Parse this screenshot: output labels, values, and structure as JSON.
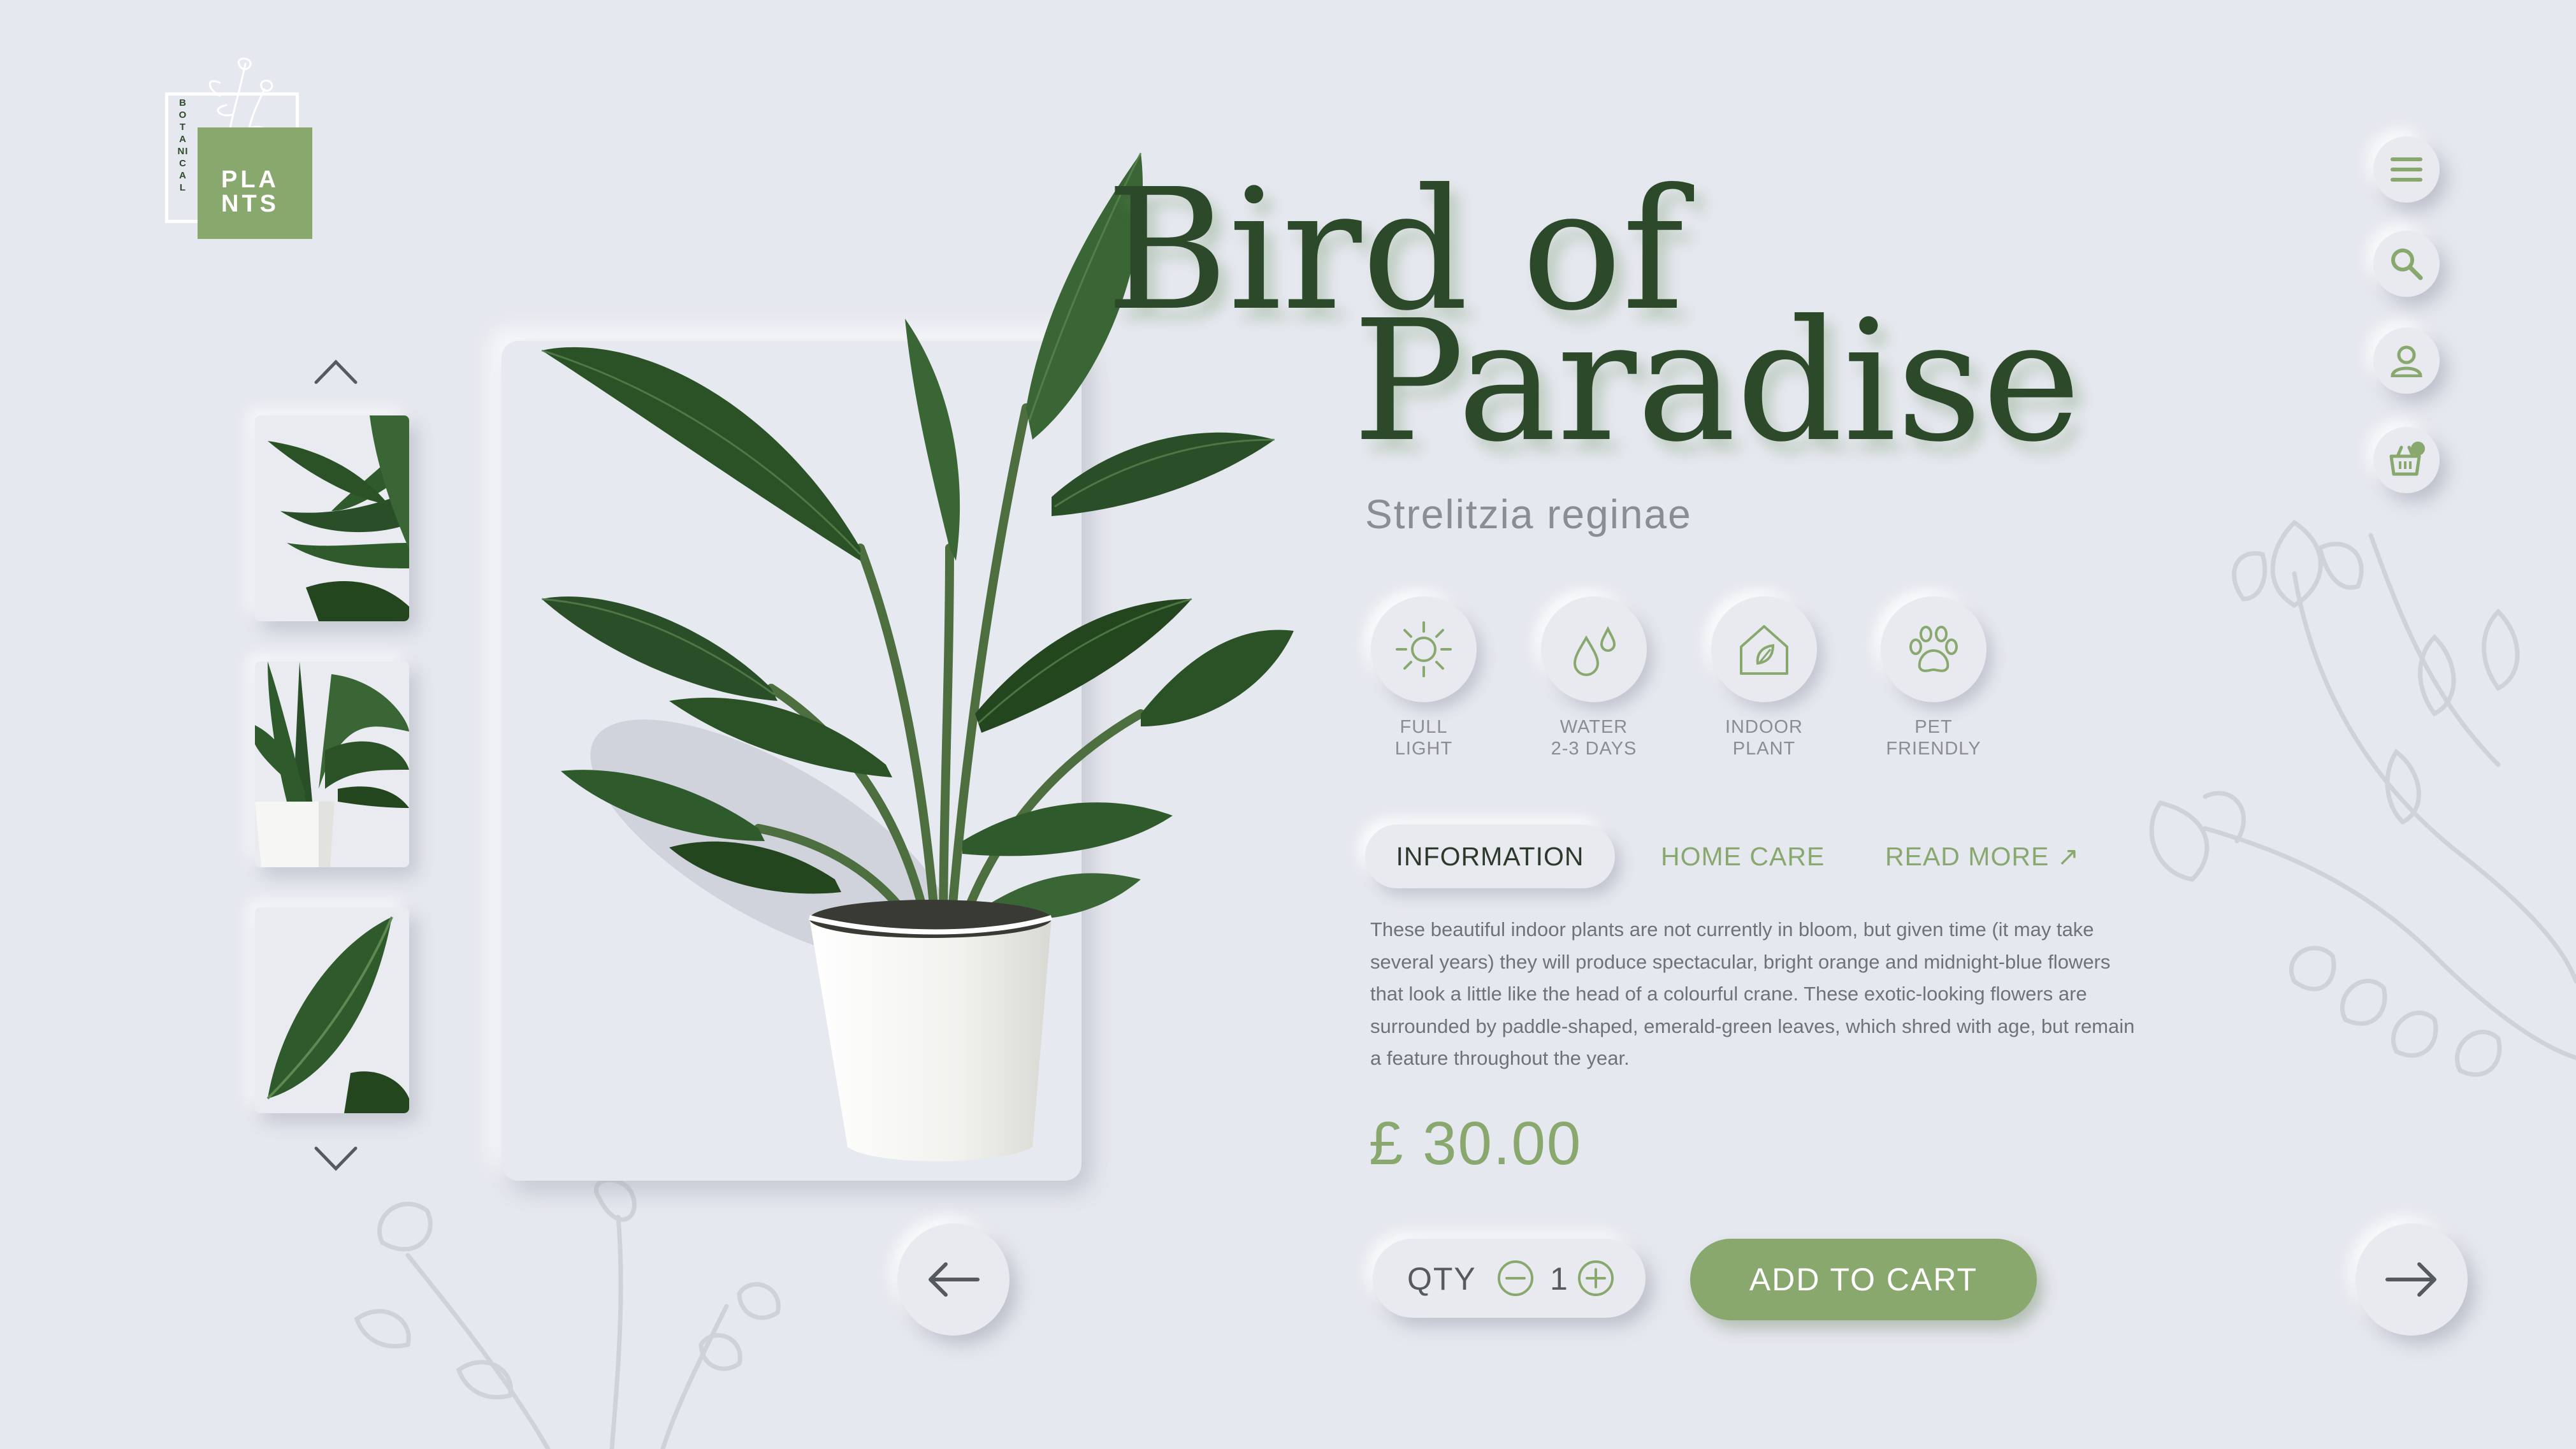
{
  "brand": {
    "vertical_text": "BOTANICAL",
    "logo_word": "PLANTS",
    "logo_line1": "PLA",
    "logo_line2": "NTS"
  },
  "product": {
    "title_line1": "Bird of",
    "title_line2": "Paradise",
    "scientific_name": "Strelitzia reginae",
    "price": "£ 30.00"
  },
  "features": [
    {
      "icon": "sun-icon",
      "line1": "FULL",
      "line2": "LIGHT"
    },
    {
      "icon": "water-drops-icon",
      "line1": "WATER",
      "line2": "2-3 DAYS"
    },
    {
      "icon": "house-leaf-icon",
      "line1": "INDOOR",
      "line2": "PLANT"
    },
    {
      "icon": "paw-icon",
      "line1": "PET",
      "line2": "FRIENDLY"
    }
  ],
  "tabs": {
    "information": "INFORMATION",
    "home_care": "HOME CARE",
    "read_more": "READ MORE ↗"
  },
  "description": "These beautiful indoor plants are not currently in bloom, but given time (it may take several years) they will produce spectacular, bright orange and midnight-blue flowers that look a little like the head of a colourful crane. These exotic-looking flowers are surrounded by paddle-shaped, emerald-green leaves, which shred with age, but remain a feature throughout the year.",
  "quantity": {
    "label": "QTY",
    "value": "1"
  },
  "add_to_cart": "ADD TO CART",
  "nav_icons": [
    "menu-icon",
    "search-icon",
    "user-icon",
    "basket-icon"
  ],
  "colors": {
    "background": "#e6e8ef",
    "accent_green": "#88a86e",
    "dark_green": "#2c4a2a",
    "leaf_green": "#2f5a2c",
    "muted_text": "#8a8d92",
    "pot_white": "#f4f4f2"
  }
}
